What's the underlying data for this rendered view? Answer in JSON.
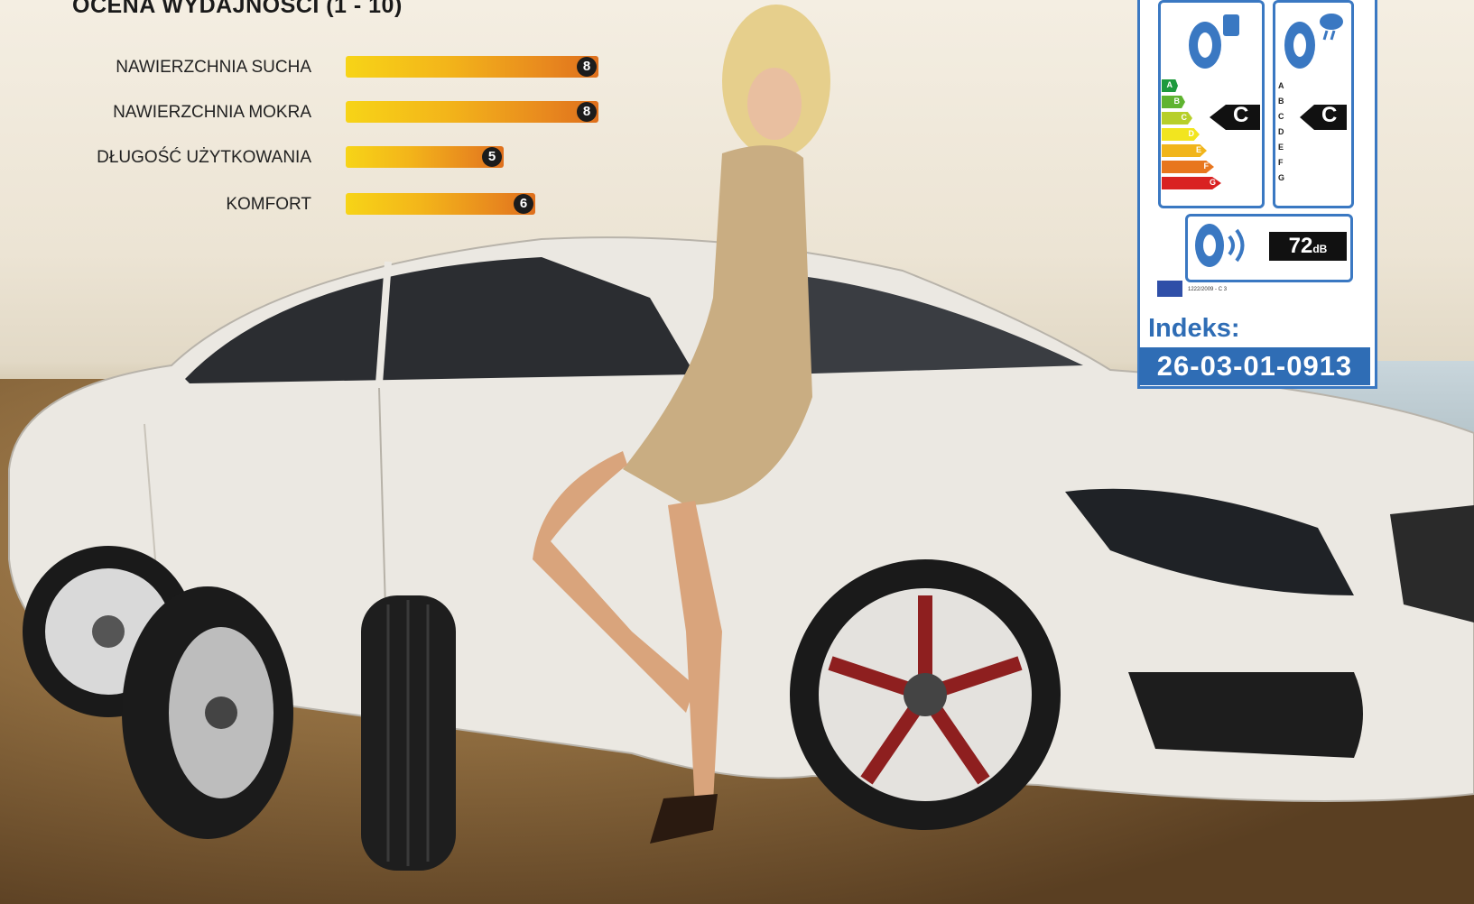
{
  "performance": {
    "title": "OCENA WYDAJNOŚCI (1 - 10)",
    "metrics": [
      {
        "label": "NAWIERZCHNIA SUCHA",
        "value": 8
      },
      {
        "label": "NAWIERZCHNIA MOKRA",
        "value": 8
      },
      {
        "label": "DŁUGOŚĆ UŻYTKOWANIA",
        "value": 5
      },
      {
        "label": "KOMFORT",
        "value": 6
      }
    ]
  },
  "eu_label": {
    "fuel_grade": "C",
    "wet_grade": "C",
    "scale": [
      "A",
      "B",
      "C",
      "D",
      "E",
      "F",
      "G"
    ],
    "noise_value": "72",
    "noise_unit": "dB",
    "regulation": "1222/2009 - C 3",
    "colors": {
      "A": "#1e9a3d",
      "B": "#5fb430",
      "C": "#b7cf2a",
      "D": "#f2e51f",
      "E": "#f1b51b",
      "F": "#e8761e",
      "G": "#d92121"
    }
  },
  "index": {
    "label": "Indeks:",
    "value": "26-03-01-0913"
  },
  "colors": {
    "accent": "#2f6db5",
    "bar_start": "#f7d417",
    "bar_end": "#de6f1c"
  }
}
